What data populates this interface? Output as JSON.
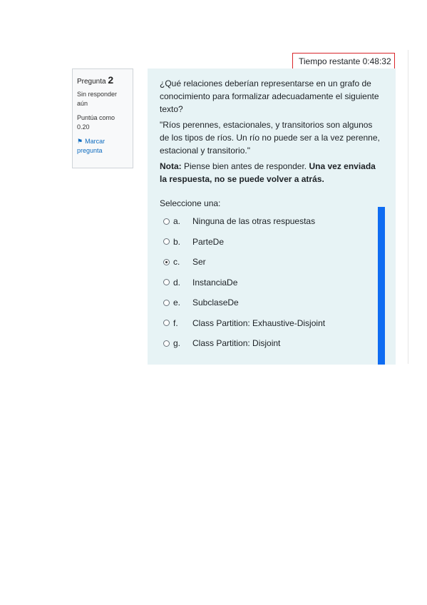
{
  "timer": {
    "text": "Tiempo restante 0:48:32",
    "border_color": "#d9262a"
  },
  "question_info": {
    "prefix": "Pregunta",
    "number": "2",
    "state": "Sin responder aún",
    "grade": "Puntúa como 0.20",
    "flag_label": "Marcar pregunta",
    "flag_icon": "flag-icon"
  },
  "question": {
    "text": "¿Qué relaciones deberían representarse en un grafo de conocimiento para formalizar adecuadamente el siguiente texto?",
    "quote": "\"Ríos perennes, estacionales, y transitorios son algunos de los tipos de ríos. Un río no puede ser a la vez perenne, estacional y transitorio.\"",
    "note_label": "Nota:",
    "note_text": " Piense bien antes de responder. ",
    "note_bold": "Una vez enviada la respuesta, no se puede volver a atrás.",
    "prompt": "Seleccione una:"
  },
  "options": [
    {
      "letter": "a.",
      "text": "Ninguna de las otras respuestas",
      "selected": false
    },
    {
      "letter": "b.",
      "text": "ParteDe",
      "selected": false
    },
    {
      "letter": "c.",
      "text": "Ser",
      "selected": true
    },
    {
      "letter": "d.",
      "text": "InstanciaDe",
      "selected": false
    },
    {
      "letter": "e.",
      "text": "SubclaseDe",
      "selected": false
    },
    {
      "letter": "f.",
      "text": "Class Partition: Exhaustive-Disjoint",
      "selected": false
    },
    {
      "letter": "g.",
      "text": "Class Partition: Disjoint",
      "selected": false
    }
  ],
  "colors": {
    "content_bg": "#e7f3f5",
    "accent": "#0f6cbf",
    "scrollbar": "#0f6cf2"
  }
}
